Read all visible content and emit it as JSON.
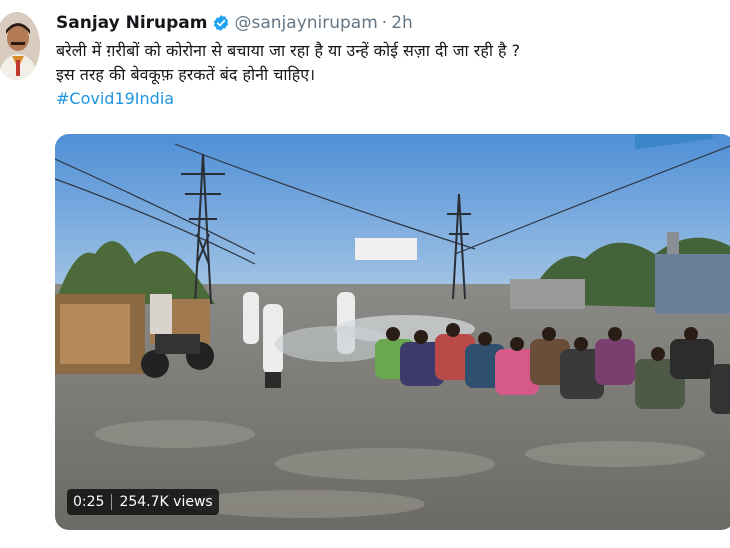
{
  "tweet": {
    "author_name": "Sanjay Nirupam",
    "handle": "@sanjaynirupam",
    "separator": "·",
    "time": "2h",
    "verified": true,
    "text_line_1": "बरेली में ग़रीबों को कोरोना से बचाया जा रहा है या उन्हें कोई सज़ा दी जा रही है ?",
    "text_line_2": "इस तरह की बेवकूफ़ हरकतें बंद होनी चाहिए।",
    "hashtag": "#Covid19India"
  },
  "video": {
    "duration": "0:25",
    "views": "254.7K views"
  },
  "colors": {
    "link": "#1b95e0",
    "verified_badge": "#1da1f2",
    "muted_text": "#657786"
  }
}
